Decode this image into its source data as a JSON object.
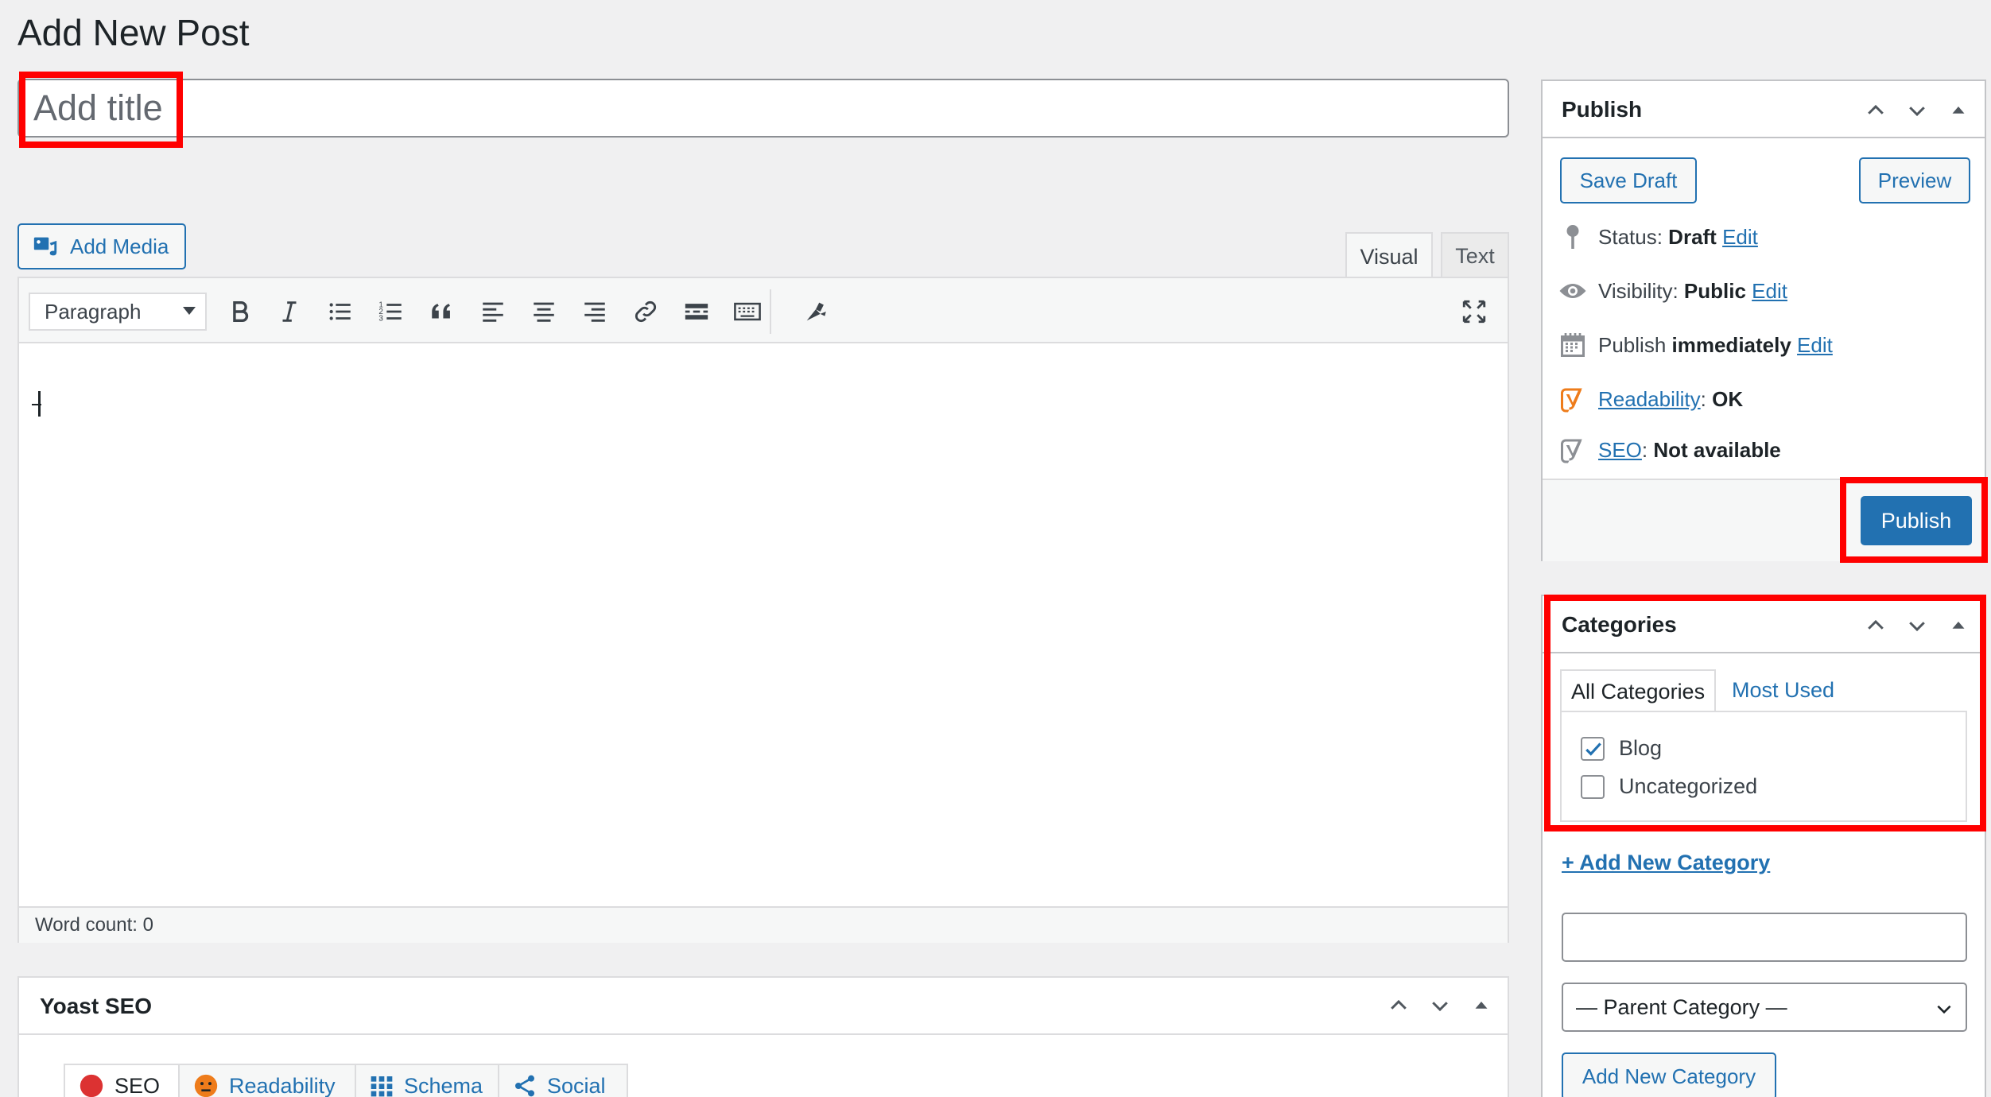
{
  "page": {
    "title": "Add New Post"
  },
  "title_field": {
    "placeholder": "Add title",
    "value": ""
  },
  "editor": {
    "add_media_label": "Add Media",
    "tabs": {
      "visual": "Visual",
      "text": "Text"
    },
    "format_select": "Paragraph",
    "toolbar_icons": [
      "bold-icon",
      "italic-icon",
      "bulleted-list-icon",
      "numbered-list-icon",
      "blockquote-icon",
      "align-left-icon",
      "align-center-icon",
      "align-right-icon",
      "link-icon",
      "read-more-icon",
      "toolbar-toggle-icon",
      "yoast-insights-icon",
      "fullscreen-icon"
    ],
    "word_count": "Word count: 0"
  },
  "yoast": {
    "title": "Yoast SEO",
    "tabs": [
      "SEO",
      "Readability",
      "Schema",
      "Social"
    ],
    "colors": {
      "seo_dot": "#dc3232",
      "readability_face": "#ee7c1b"
    }
  },
  "publish": {
    "title": "Publish",
    "save_draft": "Save Draft",
    "preview": "Preview",
    "status": {
      "label": "Status:",
      "value": "Draft",
      "edit": "Edit"
    },
    "visibility": {
      "label": "Visibility:",
      "value": "Public",
      "edit": "Edit"
    },
    "schedule": {
      "label": "Publish",
      "value": "immediately",
      "edit": "Edit"
    },
    "readability": {
      "label": "Readability",
      "value": "OK"
    },
    "seo": {
      "label": "SEO",
      "value": "Not available"
    },
    "publish_button": "Publish"
  },
  "categories": {
    "title": "Categories",
    "tabs": {
      "all": "All Categories",
      "most_used": "Most Used"
    },
    "items": [
      {
        "name": "Blog",
        "checked": true
      },
      {
        "name": "Uncategorized",
        "checked": false
      }
    ],
    "add_new_link": "+ Add New Category",
    "new_category_value": "",
    "parent_select": "— Parent Category —",
    "add_button": "Add New Category"
  },
  "colors": {
    "accent": "#2271b1",
    "highlight": "#ff0000",
    "background": "#f0f0f1"
  }
}
